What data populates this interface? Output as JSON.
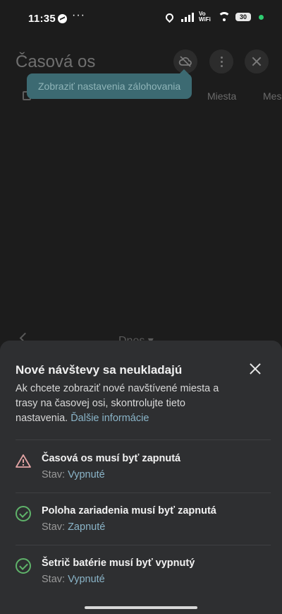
{
  "status_bar": {
    "time": "11:35",
    "more": "···",
    "vowifi": "Vo WiFi",
    "battery": "30"
  },
  "app_bar": {
    "title": "Časová os",
    "backup_icon": "cloud-off-icon",
    "menu_icon": "more-vert-icon",
    "close_icon": "close-icon"
  },
  "tooltip": {
    "text": "Zobraziť nastavenia zálohovania"
  },
  "tabs": [
    {
      "label": "Miesta"
    },
    {
      "label": "Mes"
    }
  ],
  "date_bar": {
    "label": "Dnes ▾"
  },
  "sheet": {
    "heading": "Nové návštevy sa neukladajú",
    "description": "Ak chcete zobraziť nové navštívené miesta a trasy na časovej osi, skontrolujte tieto nastavenia.",
    "link": "Ďalšie informácie",
    "items": [
      {
        "title": "Časová os musí byť zapnutá",
        "status_label": "Stav:",
        "status_value": "Vypnuté",
        "icon": "warning-icon"
      },
      {
        "title": "Poloha zariadenia musí byť zapnutá",
        "status_label": "Stav:",
        "status_value": "Zapnuté",
        "icon": "check-circle-icon"
      },
      {
        "title": "Šetrič batérie musí byť vypnutý",
        "status_label": "Stav:",
        "status_value": "Vypnuté",
        "icon": "check-circle-icon"
      }
    ]
  },
  "colors": {
    "accent_link": "#8ab4c8",
    "check_green": "#5fb36a",
    "warning_red": "#e3a4a4",
    "tooltip_bg": "#3c6a72"
  }
}
